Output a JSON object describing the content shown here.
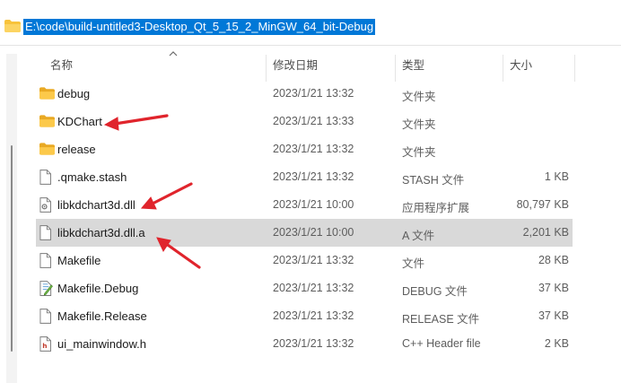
{
  "address": {
    "path": "E:\\code\\build-untitled3-Desktop_Qt_5_15_2_MinGW_64_bit-Debug",
    "folder_icon": "folder-icon"
  },
  "columns": {
    "name": "名称",
    "date": "修改日期",
    "type": "类型",
    "size": "大小"
  },
  "files": [
    {
      "name": "debug",
      "date": "2023/1/21 13:32",
      "type": "文件夹",
      "size": "",
      "icon": "folder-icon"
    },
    {
      "name": "KDChart",
      "date": "2023/1/21 13:33",
      "type": "文件夹",
      "size": "",
      "icon": "folder-icon"
    },
    {
      "name": "release",
      "date": "2023/1/21 13:32",
      "type": "文件夹",
      "size": "",
      "icon": "folder-icon"
    },
    {
      "name": ".qmake.stash",
      "date": "2023/1/21 13:32",
      "type": "STASH 文件",
      "size": "1 KB",
      "icon": "file-icon"
    },
    {
      "name": "libkdchart3d.dll",
      "date": "2023/1/21 10:00",
      "type": "应用程序扩展",
      "size": "80,797 KB",
      "icon": "dll-file-icon"
    },
    {
      "name": "libkdchart3d.dll.a",
      "date": "2023/1/21 10:00",
      "type": "A 文件",
      "size": "2,201 KB",
      "icon": "file-icon",
      "selected": true
    },
    {
      "name": "Makefile",
      "date": "2023/1/21 13:32",
      "type": "文件",
      "size": "28 KB",
      "icon": "file-icon"
    },
    {
      "name": "Makefile.Debug",
      "date": "2023/1/21 13:32",
      "type": "DEBUG 文件",
      "size": "37 KB",
      "icon": "edited-file-icon"
    },
    {
      "name": "Makefile.Release",
      "date": "2023/1/21 13:32",
      "type": "RELEASE 文件",
      "size": "37 KB",
      "icon": "file-icon"
    },
    {
      "name": "ui_mainwindow.h",
      "date": "2023/1/21 13:32",
      "type": "C++ Header file",
      "size": "2 KB",
      "icon": "header-file-icon"
    }
  ],
  "annotation_color": "#e0242c"
}
